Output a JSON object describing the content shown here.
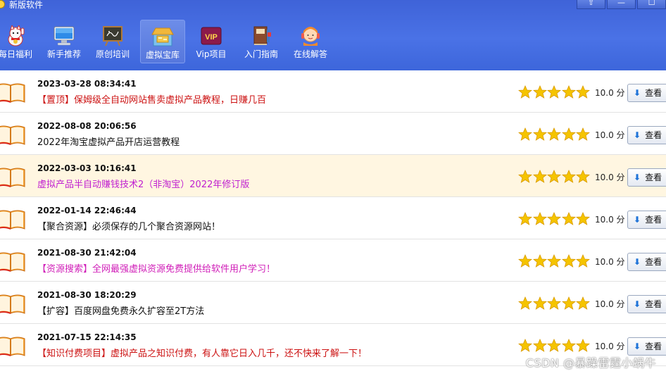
{
  "app": {
    "title": "新版软件",
    "controls": [
      "⇧",
      "—",
      "☐"
    ]
  },
  "toolbar": {
    "items": [
      {
        "label": "每日福利",
        "icon": "lucky-cat-icon"
      },
      {
        "label": "新手推荐",
        "icon": "computer-icon"
      },
      {
        "label": "原创培训",
        "icon": "blackboard-icon"
      },
      {
        "label": "虚拟宝库",
        "icon": "treasure-store-icon",
        "active": true
      },
      {
        "label": "Vip项目",
        "icon": "vip-badge-icon"
      },
      {
        "label": "入门指南",
        "icon": "books-icon"
      },
      {
        "label": "在线解答",
        "icon": "support-agent-icon"
      }
    ]
  },
  "list": {
    "view_label": "查看",
    "rows": [
      {
        "date": "2023-03-28 08:34:41",
        "title": "【置顶】保姆级全自动网站售卖虚拟产品教程，日赚几百",
        "color": "#cc1111",
        "rating": 5,
        "score": "10.0 分"
      },
      {
        "date": "2022-08-08 20:06:56",
        "title": "2022年淘宝虚拟产品开店运营教程",
        "color": "#111111",
        "rating": 5,
        "score": "10.0 分"
      },
      {
        "date": "2022-03-03 10:16:41",
        "title": "虚拟产品半自动赚钱技术2（非淘宝）2022年修订版",
        "color": "#c020d0",
        "rating": 5,
        "score": "10.0 分",
        "highlight": true
      },
      {
        "date": "2022-01-14 22:46:44",
        "title": "【聚合资源】必须保存的几个聚合资源网站！",
        "color": "#111111",
        "rating": 5,
        "score": "10.0 分"
      },
      {
        "date": "2021-08-30 21:42:04",
        "title": "【资源搜索】全网最强虚拟资源免费提供给软件用户学习！",
        "color": "#d01fb8",
        "rating": 5,
        "score": "10.0 分"
      },
      {
        "date": "2021-08-30 18:20:29",
        "title": "【扩容】百度网盘免费永久扩容至2T方法",
        "color": "#111111",
        "rating": 5,
        "score": "10.0 分"
      },
      {
        "date": "2021-07-15 22:14:35",
        "title": "【知识付费项目】虚拟产品之知识付费，有人靠它日入几千，还不快来了解一下！",
        "color": "#cc1111",
        "rating": 5,
        "score": "10.0 分"
      }
    ]
  },
  "watermark": "CSDN @暴躁雷霆小蜗牛",
  "colors": {
    "header": "#4a72e6",
    "star": "#f5c400",
    "highlight_row": "#fff6e1"
  }
}
